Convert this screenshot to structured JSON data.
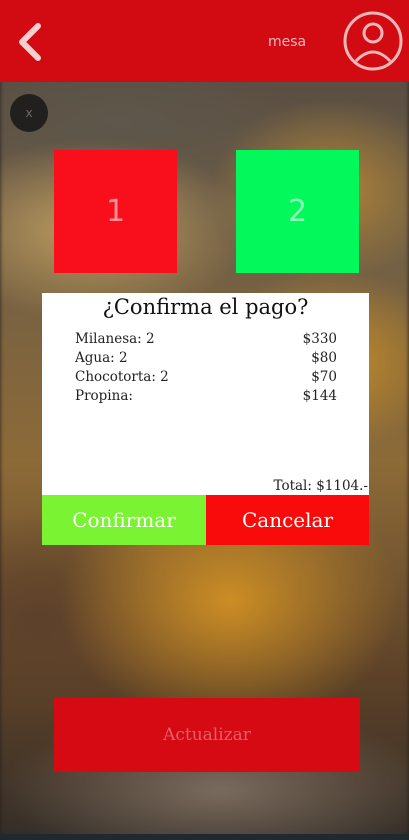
{
  "header": {
    "label": "mesa",
    "colors": {
      "bar": "#d20a12"
    }
  },
  "close_label": "x",
  "tables": [
    {
      "label": "1",
      "color": "#f90f1c"
    },
    {
      "label": "2",
      "color": "#03f85c"
    }
  ],
  "modal": {
    "title": "¿Confirma el pago?",
    "items": [
      {
        "name": "Milanesa: 2",
        "price": "$330"
      },
      {
        "name": "Agua: 2",
        "price": "$80"
      },
      {
        "name": "Chocotorta: 2",
        "price": "$70"
      },
      {
        "name": "Propina:",
        "price": "$144"
      }
    ],
    "total": "Total: $1104.-",
    "confirm_label": "Confirmar",
    "cancel_label": "Cancelar",
    "colors": {
      "confirm": "#7af333",
      "cancel": "#fa0b0b"
    }
  },
  "update_label": "Actualizar",
  "icons": [
    "back-arrow-icon",
    "user-avatar-icon",
    "close-icon"
  ]
}
